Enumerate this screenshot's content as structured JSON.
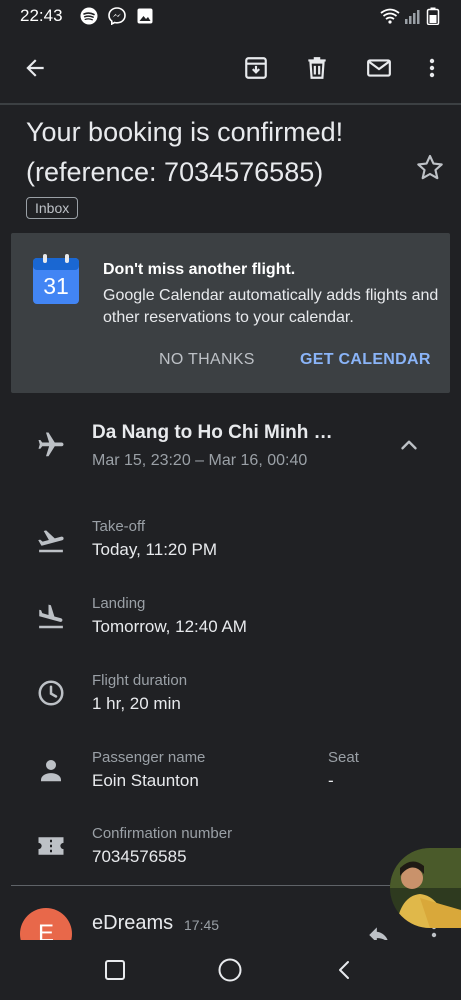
{
  "status_bar": {
    "time": "22:43",
    "left_icons": [
      "spotify-icon",
      "messenger-icon",
      "gallery-icon"
    ],
    "right_icons": [
      "wifi-icon",
      "signal-icon",
      "battery-icon"
    ]
  },
  "toolbar": {
    "icons": [
      "back-arrow-icon",
      "archive-icon",
      "delete-icon",
      "mark-unread-icon",
      "more-vert-icon"
    ]
  },
  "email": {
    "subject": "Your booking is confirmed! (reference:  7034576585)",
    "label": "Inbox"
  },
  "promo": {
    "calendar_day": "31",
    "title": "Don't miss another flight.",
    "body": "Google Calendar automatically adds flights and other reservations to your calendar.",
    "dismiss_label": "NO THANKS",
    "action_label": "GET CALENDAR"
  },
  "flight": {
    "title": "Da Nang to Ho Chi Minh …",
    "times": "Mar 15, 23:20 – Mar 16, 00:40",
    "details": {
      "takeoff_label": "Take-off",
      "takeoff_value": "Today, 11:20 PM",
      "landing_label": "Landing",
      "landing_value": "Tomorrow, 12:40 AM",
      "duration_label": "Flight duration",
      "duration_value": "1 hr, 20 min",
      "passenger_label": "Passenger name",
      "passenger_value": "Eoin Staunton",
      "seat_label": "Seat",
      "seat_value": "-",
      "confirmation_label": "Confirmation number",
      "confirmation_value": "7034576585"
    }
  },
  "message": {
    "avatar_letter": "E",
    "sender": "eDreams",
    "time": "17:45"
  },
  "nav_bar": {
    "icons": [
      "recent-apps-icon",
      "home-icon",
      "back-icon"
    ]
  },
  "colors": {
    "background": "#202124",
    "card": "#3c4043",
    "accent": "#8ab4f8",
    "avatar": "#e8684a"
  }
}
